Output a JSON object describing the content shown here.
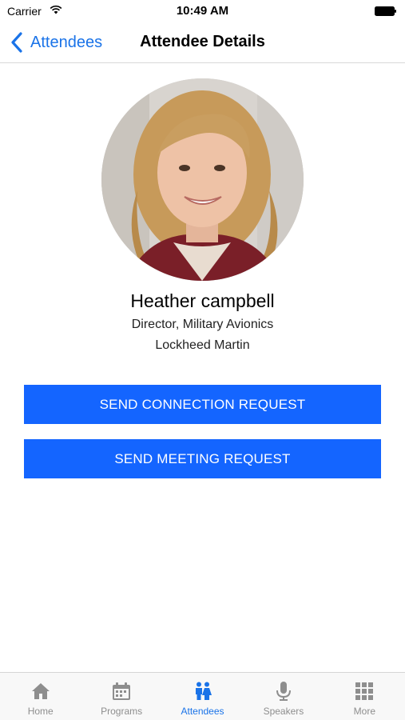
{
  "status_bar": {
    "carrier": "Carrier",
    "time": "10:49 AM"
  },
  "nav": {
    "back_label": "Attendees",
    "title": "Attendee Details"
  },
  "attendee": {
    "name": "Heather campbell",
    "title": "Director, Military Avionics",
    "company": "Lockheed Martin"
  },
  "actions": {
    "connect_label": "SEND CONNECTION REQUEST",
    "meeting_label": "SEND MEETING REQUEST"
  },
  "tabs": [
    {
      "label": "Home",
      "icon": "home-icon"
    },
    {
      "label": "Programs",
      "icon": "calendar-icon"
    },
    {
      "label": "Attendees",
      "icon": "people-icon",
      "active": true
    },
    {
      "label": "Speakers",
      "icon": "microphone-icon"
    },
    {
      "label": "More",
      "icon": "grid-icon"
    }
  ],
  "colors": {
    "accent": "#1a73e8",
    "button": "#1465ff",
    "tab_inactive": "#8e8e8e"
  }
}
